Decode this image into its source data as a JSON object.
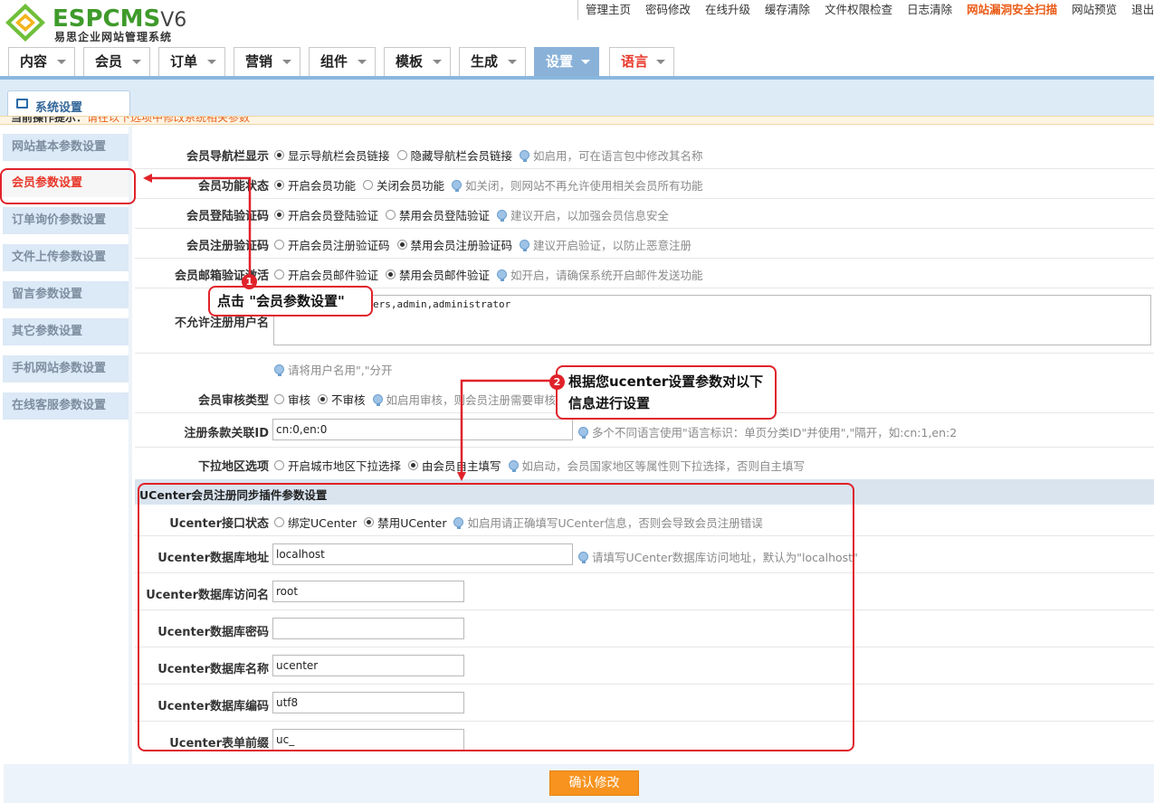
{
  "brand": {
    "name": "ESPCMS",
    "version": "V6",
    "subtitle": "易思企业网站管理系统"
  },
  "top_links": [
    "管理主页",
    "密码修改",
    "在线升级",
    "缓存清除",
    "文件权限检查",
    "日志清除",
    "网站漏洞安全扫描",
    "网站预览",
    "退出"
  ],
  "main_nav": [
    {
      "label": "内容"
    },
    {
      "label": "会员"
    },
    {
      "label": "订单"
    },
    {
      "label": "营销"
    },
    {
      "label": "组件"
    },
    {
      "label": "模板"
    },
    {
      "label": "生成"
    },
    {
      "label": "设置"
    },
    {
      "label": "语言"
    }
  ],
  "sub_tab": "系统设置",
  "hint": {
    "prefix": "当前操作提示：",
    "text": "请在以下选项中修改系统相关参数"
  },
  "sidebar": [
    {
      "label": "网站基本参数设置"
    },
    {
      "label": "会员参数设置"
    },
    {
      "label": "订单询价参数设置"
    },
    {
      "label": "文件上传参数设置"
    },
    {
      "label": "留言参数设置"
    },
    {
      "label": "其它参数设置"
    },
    {
      "label": "手机网站参数设置"
    },
    {
      "label": "在线客服参数设置"
    }
  ],
  "settings": {
    "nav_display": {
      "label": "会员导航栏显示",
      "opt1": "显示导航栏会员链接",
      "opt2": "隐藏导航栏会员链接",
      "tip": "如启用，可在语言包中修改其名称"
    },
    "member_func": {
      "label": "会员功能状态",
      "opt1": "开启会员功能",
      "opt2": "关闭会员功能",
      "tip": "如关闭，则网站不再允许使用相关会员所有功能"
    },
    "login_captcha": {
      "label": "会员登陆验证码",
      "opt1": "开启会员登陆验证",
      "opt2": "禁用会员登陆验证",
      "tip": "建议开启，以加强会员信息安全"
    },
    "reg_captcha": {
      "label": "会员注册验证码",
      "opt1": "开启会员注册验证码",
      "opt2": "禁用会员注册验证码",
      "tip": "建议开启验证，以防止恶意注册"
    },
    "mail_verify": {
      "label": "会员邮箱验证激活",
      "opt1": "开启会员邮件验证",
      "opt2": "禁用会员邮件验证",
      "tip": "如开启，请确保系统开启邮件发送功能"
    },
    "forbidden_names": {
      "label": "不允许注册用户名",
      "value": "ftp,mail,user,users,admin,administrator",
      "tip": "请将用户名用\",\"分开"
    },
    "review": {
      "label": "会员审核类型",
      "opt1": "审核",
      "opt2": "不审核",
      "tip": "如启用审核，则会员注册需要审核后才能登录"
    },
    "terms_id": {
      "label": "注册条款关联ID",
      "value": "cn:0,en:0",
      "tip": "多个不同语言使用\"语言标识：单页分类ID\"并使用\",\"隔开，如:cn:1,en:2"
    },
    "region": {
      "label": "下拉地区选项",
      "opt1": "开启城市地区下拉选择",
      "opt2": "由会员自主填写",
      "tip": "如启动，会员国家地区等属性则下拉选择，否则自主填写"
    }
  },
  "ucenter": {
    "section_title": "UCenter会员注册同步插件参数设置",
    "status": {
      "label": "Ucenter接口状态",
      "opt1": "绑定UCenter",
      "opt2": "禁用UCenter",
      "tip": "如启用请正确填写UCenter信息，否则会导致会员注册错误"
    },
    "db_host": {
      "label": "Ucenter数据库地址",
      "value": "localhost",
      "tip": "请填写UCenter数据库访问地址，默认为\"localhost\""
    },
    "db_user": {
      "label": "Ucenter数据库访问名",
      "value": "root"
    },
    "db_pass": {
      "label": "Ucenter数据库密码",
      "value": ""
    },
    "db_name": {
      "label": "Ucenter数据库名称",
      "value": "ucenter"
    },
    "db_charset": {
      "label": "Ucenter数据库编码",
      "value": "utf8"
    },
    "table_prefix": {
      "label": "Ucenter表单前缀",
      "value": "uc_"
    }
  },
  "submit_label": "确认修改",
  "annotations": {
    "step1": {
      "num": "1",
      "text": "点击 \"会员参数设置\""
    },
    "step2": {
      "num": "2",
      "text": "根据您ucenter设置参数对以下信息进行设置"
    }
  },
  "colors": {
    "accent": "#8ab2d9",
    "annotation": "#e0222a",
    "button": "#f7931e",
    "hot_link": "#ea5b16",
    "brand_green": "#3e9a2a"
  }
}
